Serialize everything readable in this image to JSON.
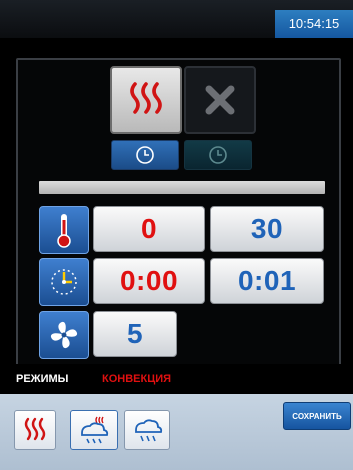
{
  "header": {
    "time": "10:54:15"
  },
  "mode_buttons": {
    "heat_icon": "heat-waves-icon",
    "cancel_icon": "close-icon"
  },
  "timer_buttons": {
    "icon": "clock-icon"
  },
  "rows": {
    "temperature": {
      "icon": "thermometer-icon",
      "current": "0",
      "target": "30"
    },
    "time": {
      "icon": "timer-icon",
      "current": "0:00",
      "target": "0:01"
    },
    "fan": {
      "icon": "fan-icon",
      "speed": "5"
    }
  },
  "modes_bar": {
    "label": "РЕЖИМЫ",
    "value": "КОНВЕКЦИЯ"
  },
  "bottom": {
    "save_label": "СОХРАНИТЬ",
    "buttons": [
      "heat-waves-icon",
      "steam-fan-icon",
      "fan-steam-icon"
    ]
  },
  "colors": {
    "accent_blue": "#1f63b8",
    "value_red": "#e01010",
    "modes_red": "#e01010"
  }
}
